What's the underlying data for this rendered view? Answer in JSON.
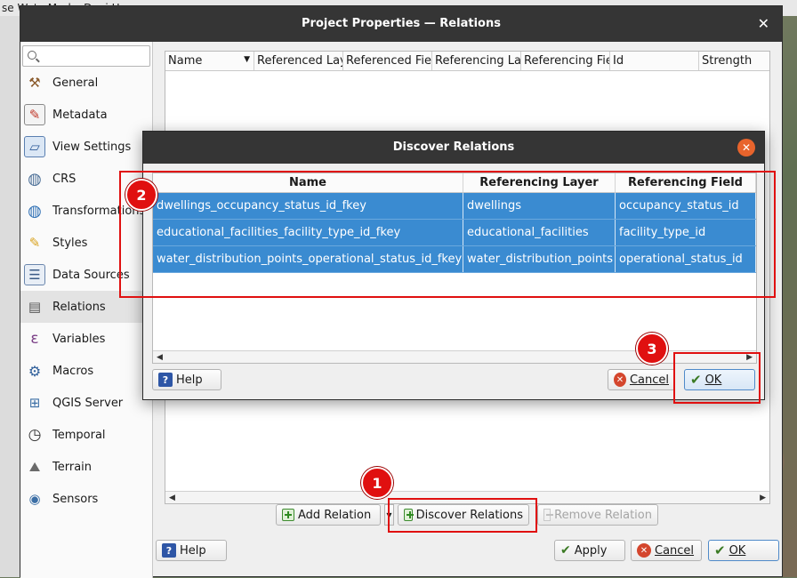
{
  "background": {
    "menubar_text": "se   Wate  Marke  D   e i    H  "
  },
  "window": {
    "title": "Project Properties — Relations",
    "close_glyph": "✕"
  },
  "sidebar": {
    "search_placeholder": "",
    "items": [
      {
        "label": "General",
        "icon": "tools-icon"
      },
      {
        "label": "Metadata",
        "icon": "metadata-icon"
      },
      {
        "label": "View Settings",
        "icon": "view-settings-icon"
      },
      {
        "label": "CRS",
        "icon": "globe-icon"
      },
      {
        "label": "Transformations",
        "icon": "transformations-icon"
      },
      {
        "label": "Styles",
        "icon": "styles-icon"
      },
      {
        "label": "Data Sources",
        "icon": "data-sources-icon"
      },
      {
        "label": "Relations",
        "icon": "relations-icon",
        "active": true
      },
      {
        "label": "Variables",
        "icon": "variables-icon"
      },
      {
        "label": "Macros",
        "icon": "macros-icon"
      },
      {
        "label": "QGIS Server",
        "icon": "server-icon"
      },
      {
        "label": "Temporal",
        "icon": "clock-icon"
      },
      {
        "label": "Terrain",
        "icon": "terrain-icon"
      },
      {
        "label": "Sensors",
        "icon": "sensors-icon"
      }
    ]
  },
  "relations_table": {
    "columns": [
      "Name",
      "Referenced Lay",
      "Referenced Fie",
      "Referencing La",
      "Referencing Fie",
      "Id",
      "Strength"
    ]
  },
  "actions": {
    "add_relation": "Add Relation",
    "dropdown_glyph": "▼",
    "discover_relations": "Discover Relations",
    "remove_relation": "Remove Relation"
  },
  "footer": {
    "help": "Help",
    "apply": "Apply",
    "cancel": "Cancel",
    "ok": "OK"
  },
  "discover_dialog": {
    "title": "Discover Relations",
    "close_glyph": "✕",
    "columns": [
      "Name",
      "Referencing Layer",
      "Referencing Field"
    ],
    "rows": [
      {
        "name": "dwellings_occupancy_status_id_fkey",
        "layer": "dwellings",
        "field": "occupancy_status_id"
      },
      {
        "name": "educational_facilities_facility_type_id_fkey",
        "layer": "educational_facilities",
        "field": "facility_type_id"
      },
      {
        "name": "water_distribution_points_operational_status_id_fkey",
        "layer": "water_distribution_points",
        "field": "operational_status_id"
      }
    ],
    "help": "Help",
    "cancel": "Cancel",
    "ok": "OK"
  },
  "annotations": [
    "1",
    "2",
    "3"
  ],
  "colors": {
    "title_bar": "#353535",
    "selection": "#3a8bd1",
    "annotation_red": "#e01010",
    "close_orange": "#e8642c"
  }
}
